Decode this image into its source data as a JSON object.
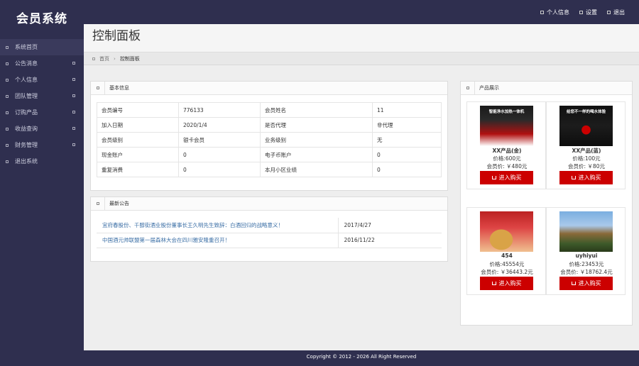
{
  "app": {
    "title": "会员系统"
  },
  "top_links": [
    {
      "label": "个人信息"
    },
    {
      "label": "设置"
    },
    {
      "label": "退出"
    }
  ],
  "sidebar": {
    "items": [
      {
        "label": "系统首页"
      },
      {
        "label": "公告消息"
      },
      {
        "label": "个人信息"
      },
      {
        "label": "团队管理"
      },
      {
        "label": "订购产品"
      },
      {
        "label": "收益查询"
      },
      {
        "label": "财务管理"
      },
      {
        "label": "退出系统"
      }
    ]
  },
  "page": {
    "title": "控制面板",
    "breadcrumb": {
      "home": "首页",
      "current": "控制面板"
    }
  },
  "basic_info": {
    "title": "基本信息",
    "rows": [
      {
        "l1": "会员编号",
        "v1": "776133",
        "l2": "会员姓名",
        "v2": "11"
      },
      {
        "l1": "加入日期",
        "v1": "2020/1/4",
        "l2": "是否代理",
        "v2": "非代理"
      },
      {
        "l1": "会员级别",
        "v1": "银卡会员",
        "l2": "业务级别",
        "v2": "无"
      },
      {
        "l1": "现金账户",
        "v1": "0",
        "l2": "电子币账户",
        "v2": "0"
      },
      {
        "l1": "重复消费",
        "v1": "0",
        "l2": "本月小区业绩",
        "v2": "0"
      }
    ]
  },
  "notices": {
    "title": "最新公告",
    "items": [
      {
        "text": "宜府春股份、千醇街酒业股份董事长王久明先生致辞：白酒回归的战略意义！",
        "date": "2017/4/27"
      },
      {
        "text": "中国酒元帅联盟第一届森林大会在四川雅安隆重召开！",
        "date": "2016/11/22"
      }
    ]
  },
  "products": {
    "title": "产品展示",
    "buy_label": "进入购买",
    "items": [
      {
        "name": "XX产品(金)",
        "price": "价格:600元",
        "member_price": "会员价: ￥480元",
        "banner": "智能净水加热一体机"
      },
      {
        "name": "XX产品(蓝)",
        "price": "价格:100元",
        "member_price": "会员价: ￥80元",
        "banner": "给您不一样的喝水体验"
      },
      {
        "name": "454",
        "price": "价格:45554元",
        "member_price": "会员价: ￥36443.2元",
        "banner": ""
      },
      {
        "name": "uyhiyui",
        "price": "价格:23453元",
        "member_price": "会员价: ￥18762.4元",
        "banner": ""
      }
    ]
  },
  "footer": {
    "text": "Copyright © 2012 - 2026  All Right Reserved"
  },
  "colors": {
    "sidebar_bg": "#2f2f4f",
    "buy_button": "#cc0000",
    "notice_link": "#3a6ea5"
  }
}
